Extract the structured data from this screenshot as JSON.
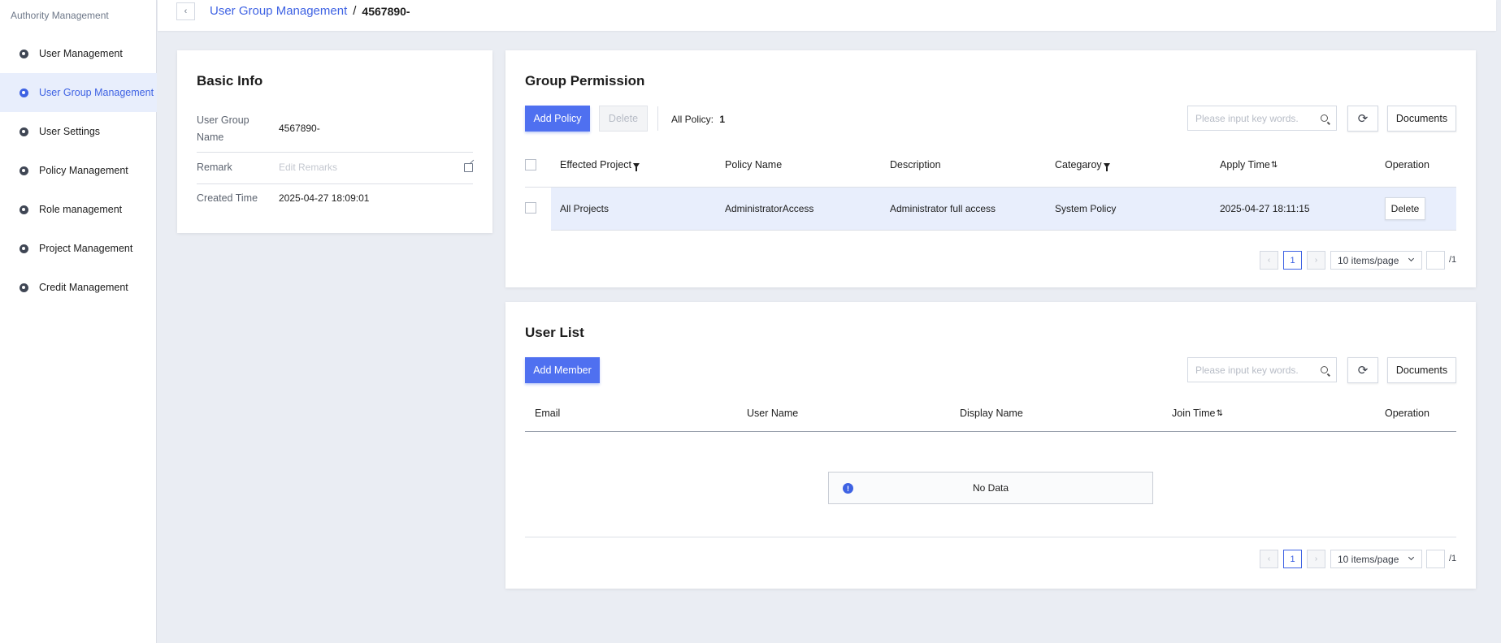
{
  "sidebar": {
    "title": "Authority Management",
    "items": [
      {
        "label": "User Management",
        "icon": "settings-icon"
      },
      {
        "label": "User Group Management",
        "icon": "settings-icon",
        "active": true
      },
      {
        "label": "User Settings",
        "icon": "settings-icon"
      },
      {
        "label": "Policy Management",
        "icon": "settings-icon"
      },
      {
        "label": "Role management",
        "icon": "settings-icon"
      },
      {
        "label": "Project Management",
        "icon": "settings-icon"
      },
      {
        "label": "Credit Management",
        "icon": "settings-icon"
      }
    ]
  },
  "breadcrumb": {
    "back_icon": "chevron-left-icon",
    "parent": "User Group Management",
    "separator": "/",
    "current": "4567890-"
  },
  "basic_info": {
    "title": "Basic Info",
    "name_label": "User Group Name",
    "name_value": "4567890-",
    "remark_label": "Remark",
    "remark_placeholder": "Edit Remarks",
    "created_label": "Created Time",
    "created_value": "2025-04-27 18:09:01"
  },
  "group_permission": {
    "title": "Group Permission",
    "add_label": "Add Policy",
    "delete_label": "Delete",
    "total_label": "All Policy:",
    "total_value": "1",
    "search_placeholder": "Please input key words.",
    "documents_label": "Documents",
    "columns": [
      "Effected Project",
      "Policy Name",
      "Description",
      "Categaroy",
      "Apply Time",
      "Operation"
    ],
    "rows": [
      {
        "project": "All Projects",
        "policy": "AdministratorAccess",
        "description": "Administrator full access",
        "category": "System Policy",
        "apply_time": "2025-04-27 18:11:15",
        "operation": "Delete"
      }
    ],
    "pager": {
      "page": "1",
      "size": "10 items/page",
      "total": "/1"
    }
  },
  "user_list": {
    "title": "User List",
    "add_label": "Add Member",
    "search_placeholder": "Please input key words.",
    "documents_label": "Documents",
    "columns": [
      "Email",
      "User Name",
      "Display Name",
      "Join Time",
      "Operation"
    ],
    "empty_text": "No Data",
    "pager": {
      "page": "1",
      "size": "10 items/page",
      "total": "/1"
    }
  },
  "colors": {
    "accent": "#3e62e3",
    "primary_button": "#4f70f0",
    "active_row": "#e8eefc",
    "background": "#eaedf3"
  }
}
